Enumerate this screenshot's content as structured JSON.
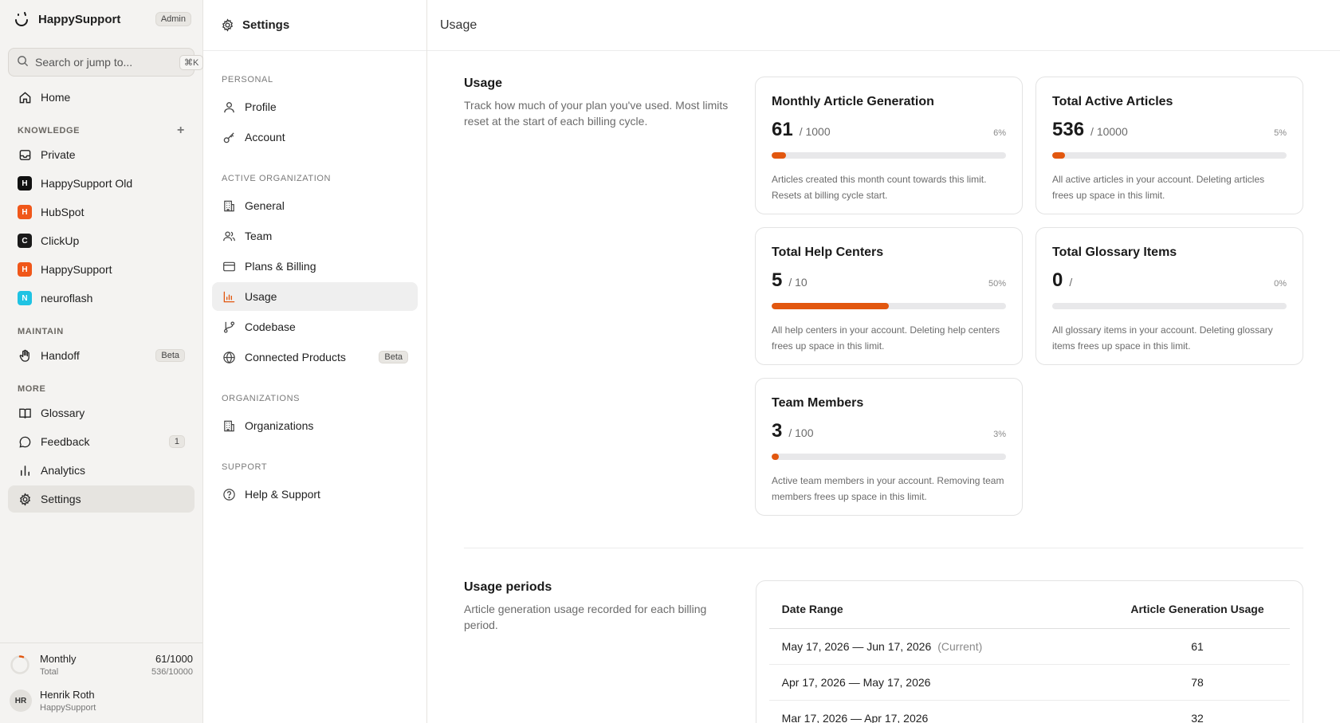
{
  "brand": {
    "name": "HappySupport",
    "badge": "Admin"
  },
  "search": {
    "placeholder": "Search or jump to...",
    "shortcut": "⌘K"
  },
  "sidebar": {
    "home": "Home",
    "knowledge_title": "KNOWLEDGE",
    "knowledge": [
      {
        "label": "Private",
        "icon": "inbox-icon"
      },
      {
        "label": "HappySupport Old",
        "letter": "H",
        "color": "#111111"
      },
      {
        "label": "HubSpot",
        "letter": "H",
        "color": "#f0571a"
      },
      {
        "label": "ClickUp",
        "letter": "C",
        "color": "#1a1a1a"
      },
      {
        "label": "HappySupport",
        "letter": "H",
        "color": "#f0571a"
      },
      {
        "label": "neuroflash",
        "letter": "N",
        "color": "#1fc3e3"
      }
    ],
    "maintain_title": "MAINTAIN",
    "handoff": "Handoff",
    "handoff_badge": "Beta",
    "more_title": "MORE",
    "glossary": "Glossary",
    "feedback": "Feedback",
    "feedback_count": "1",
    "analytics": "Analytics",
    "settings": "Settings",
    "usage_mini": {
      "label1": "Monthly",
      "label2": "Total",
      "value1": "61/1000",
      "value2": "536/10000",
      "progress": 0.061
    },
    "user": {
      "initials": "HR",
      "name": "Henrik Roth",
      "org": "HappySupport"
    }
  },
  "settings_nav": {
    "title": "Settings",
    "personal_title": "PERSONAL",
    "profile": "Profile",
    "account": "Account",
    "active_org_title": "ACTIVE ORGANIZATION",
    "general": "General",
    "team": "Team",
    "billing": "Plans & Billing",
    "usage": "Usage",
    "codebase": "Codebase",
    "connected": "Connected Products",
    "connected_badge": "Beta",
    "orgs_title": "ORGANIZATIONS",
    "organizations": "Organizations",
    "support_title": "SUPPORT",
    "help": "Help & Support"
  },
  "main": {
    "header": "Usage",
    "usage": {
      "title": "Usage",
      "desc": "Track how much of your plan you've used. Most limits reset at the start of each billing cycle.",
      "cards": [
        {
          "title": "Monthly Article Generation",
          "value": "61",
          "limit": "/ 1000",
          "pct": "6%",
          "fill": 0.061,
          "desc": "Articles created this month count towards this limit. Resets at billing cycle start."
        },
        {
          "title": "Total Active Articles",
          "value": "536",
          "limit": "/ 10000",
          "pct": "5%",
          "fill": 0.054,
          "desc": "All active articles in your account. Deleting articles frees up space in this limit."
        },
        {
          "title": "Total Help Centers",
          "value": "5",
          "limit": "/ 10",
          "pct": "50%",
          "fill": 0.5,
          "desc": "All help centers in your account. Deleting help centers frees up space in this limit."
        },
        {
          "title": "Total Glossary Items",
          "value": "0",
          "limit": "/",
          "pct": "0%",
          "fill": 0,
          "desc": "All glossary items in your account. Deleting glossary items frees up space in this limit."
        },
        {
          "title": "Team Members",
          "value": "3",
          "limit": "/ 100",
          "pct": "3%",
          "fill": 0.03,
          "desc": "Active team members in your account. Removing team members frees up space in this limit."
        }
      ]
    },
    "periods": {
      "title": "Usage periods",
      "desc": "Article generation usage recorded for each billing period.",
      "col1": "Date Range",
      "col2": "Article Generation Usage",
      "current_label": "(Current)",
      "rows": [
        {
          "range": "May 17, 2026 — Jun 17, 2026",
          "usage": "61"
        },
        {
          "range": "Apr 17, 2026 — May 17, 2026",
          "usage": "78"
        },
        {
          "range": "Mar 17, 2026 — Apr 17, 2026",
          "usage": "32"
        }
      ]
    }
  }
}
